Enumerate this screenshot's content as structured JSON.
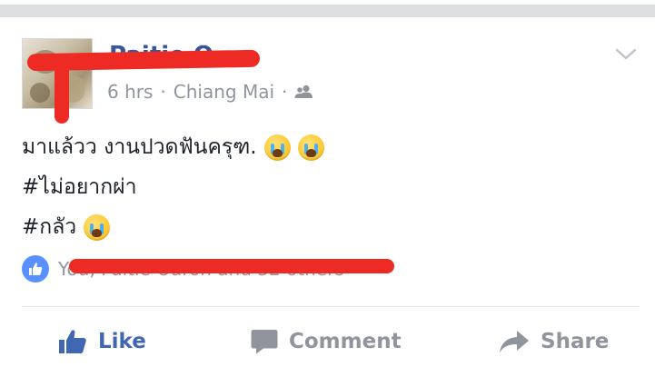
{
  "post": {
    "poster_name": "Paitie O",
    "time": "6 hrs",
    "separator": "·",
    "location": "Chiang Mai",
    "audience_icon": "friends-icon",
    "menu_icon": "chevron-down-icon",
    "text_line_1": "มาแล้วว งานปวดฟันครุฑ.",
    "text_line_2": "#ไม่อยากผ่า",
    "text_line_3": "#กลัว",
    "emoji": "loudly-crying-face"
  },
  "reactions": {
    "icon": "like-badge-icon",
    "summary": "You, Paitie Oaron and 32 others"
  },
  "actions": {
    "like_label": "Like",
    "comment_label": "Comment",
    "share_label": "Share"
  },
  "colors": {
    "link_blue": "#365899",
    "like_blue": "#4267b2",
    "muted_gray": "#90949c",
    "redaction_red": "#ee2a24",
    "reaction_badge": "#5890ff"
  }
}
